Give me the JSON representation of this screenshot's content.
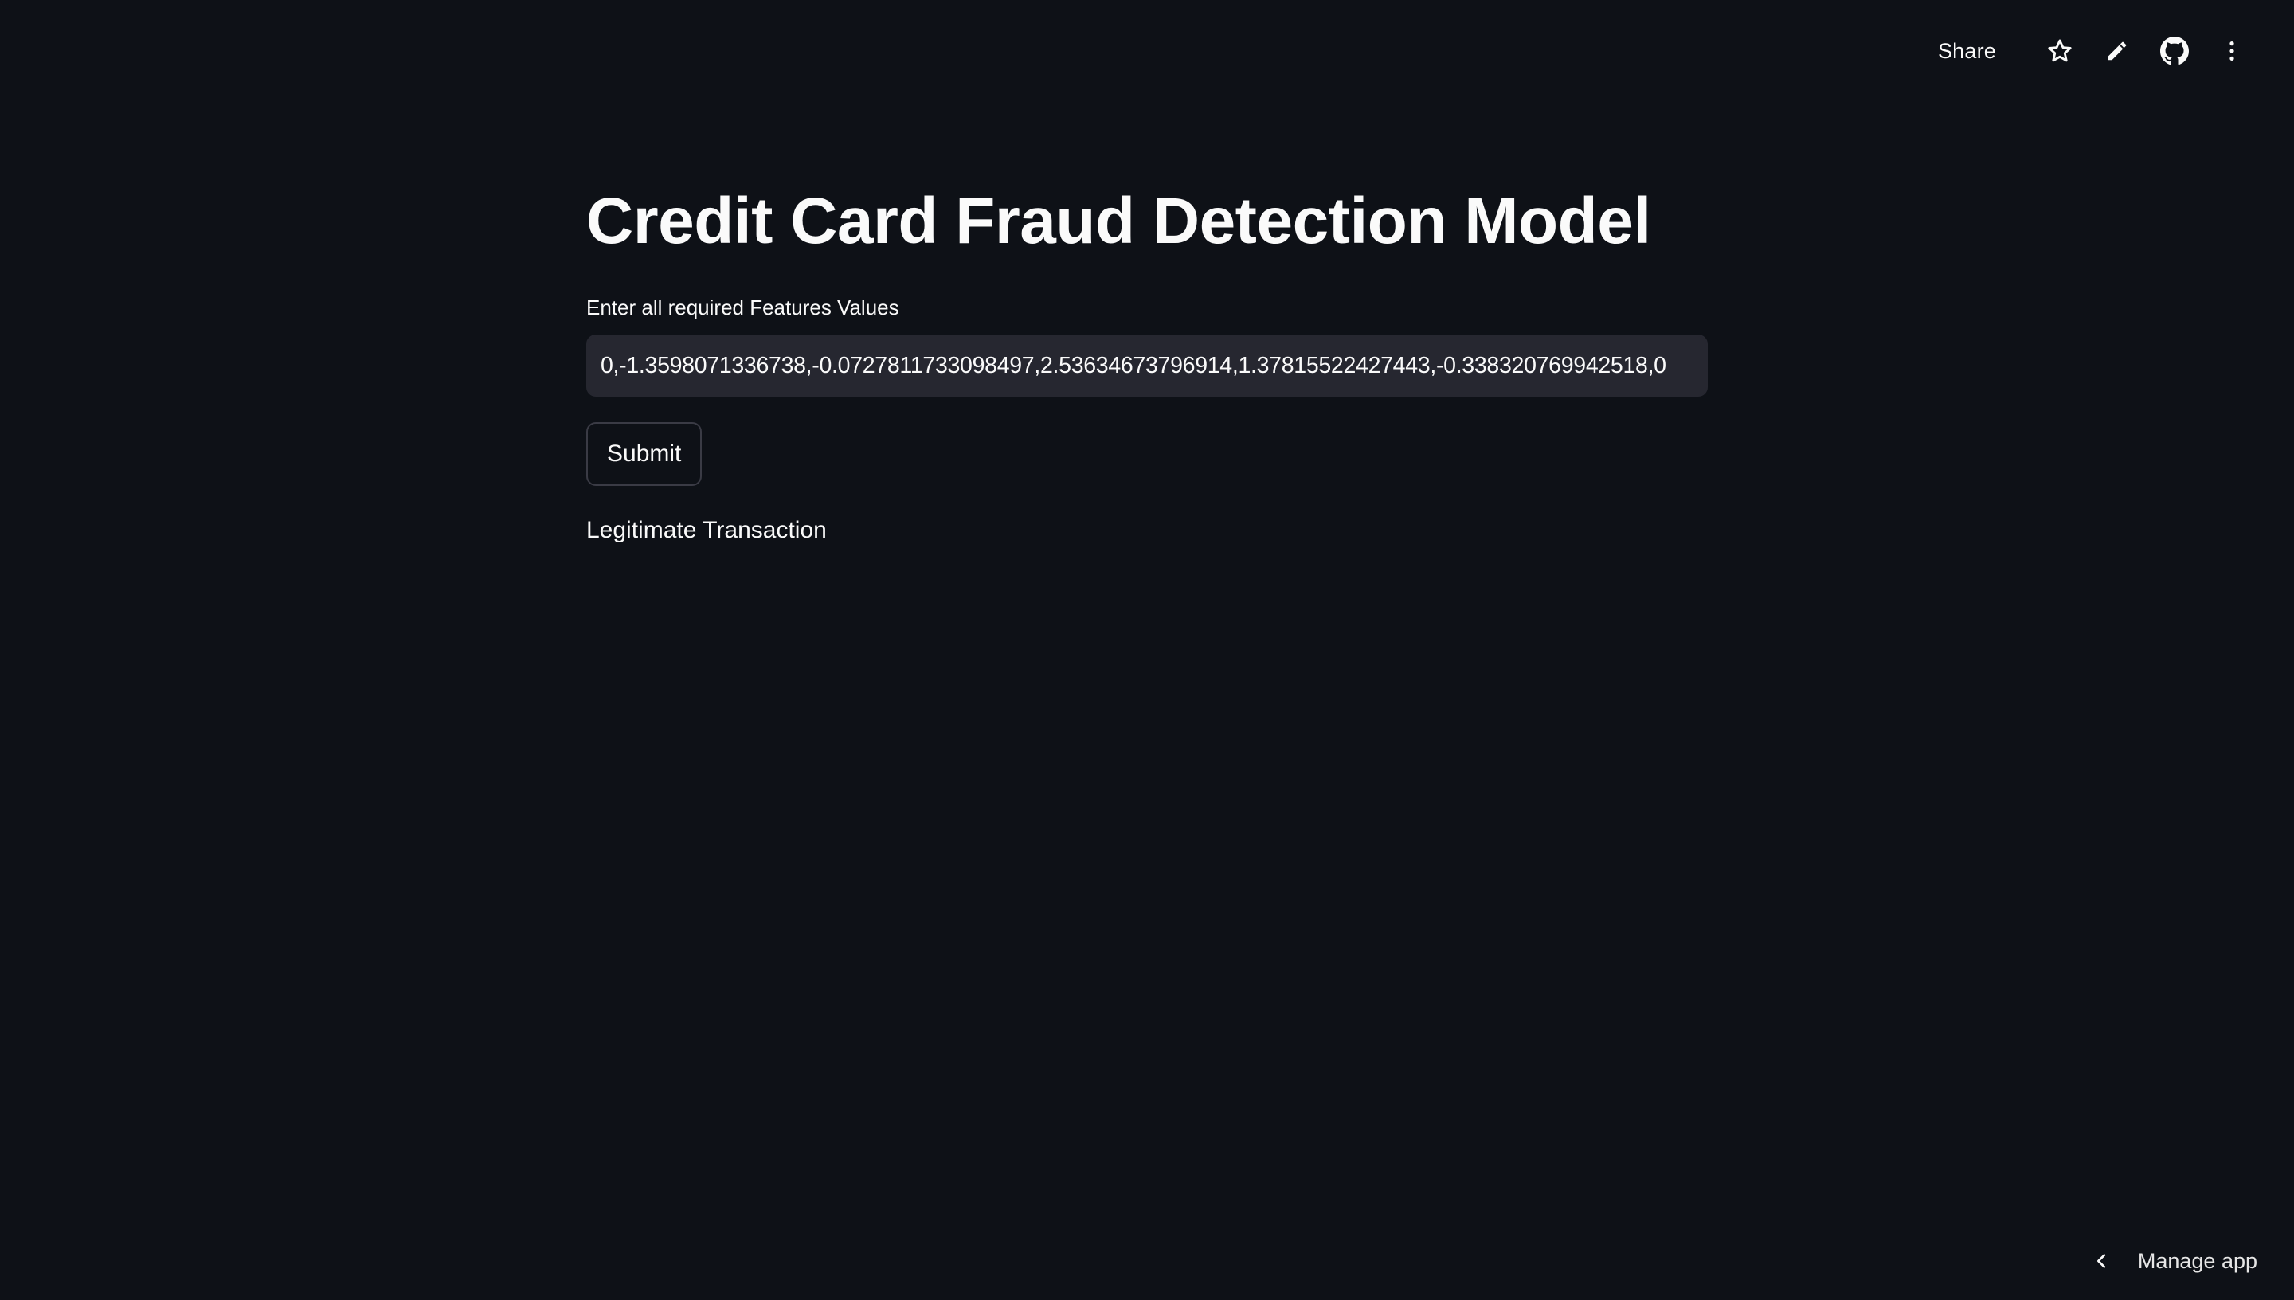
{
  "header": {
    "share_label": "Share",
    "icons": [
      "star-icon",
      "pencil-icon",
      "github-icon",
      "kebab-menu-icon"
    ]
  },
  "main": {
    "title": "Credit Card Fraud Detection Model",
    "input_label": "Enter all required Features Values",
    "input_value": "0,-1.3598071336738,-0.0727811733098497,2.53634673796914,1.37815522427443,-0.338320769942518,0",
    "submit_label": "Submit",
    "result": "Legitimate Transaction"
  },
  "footer": {
    "manage_app_label": "Manage app"
  },
  "colors": {
    "background": "#0e1117",
    "input_background": "#262730",
    "text": "#fafafa"
  }
}
